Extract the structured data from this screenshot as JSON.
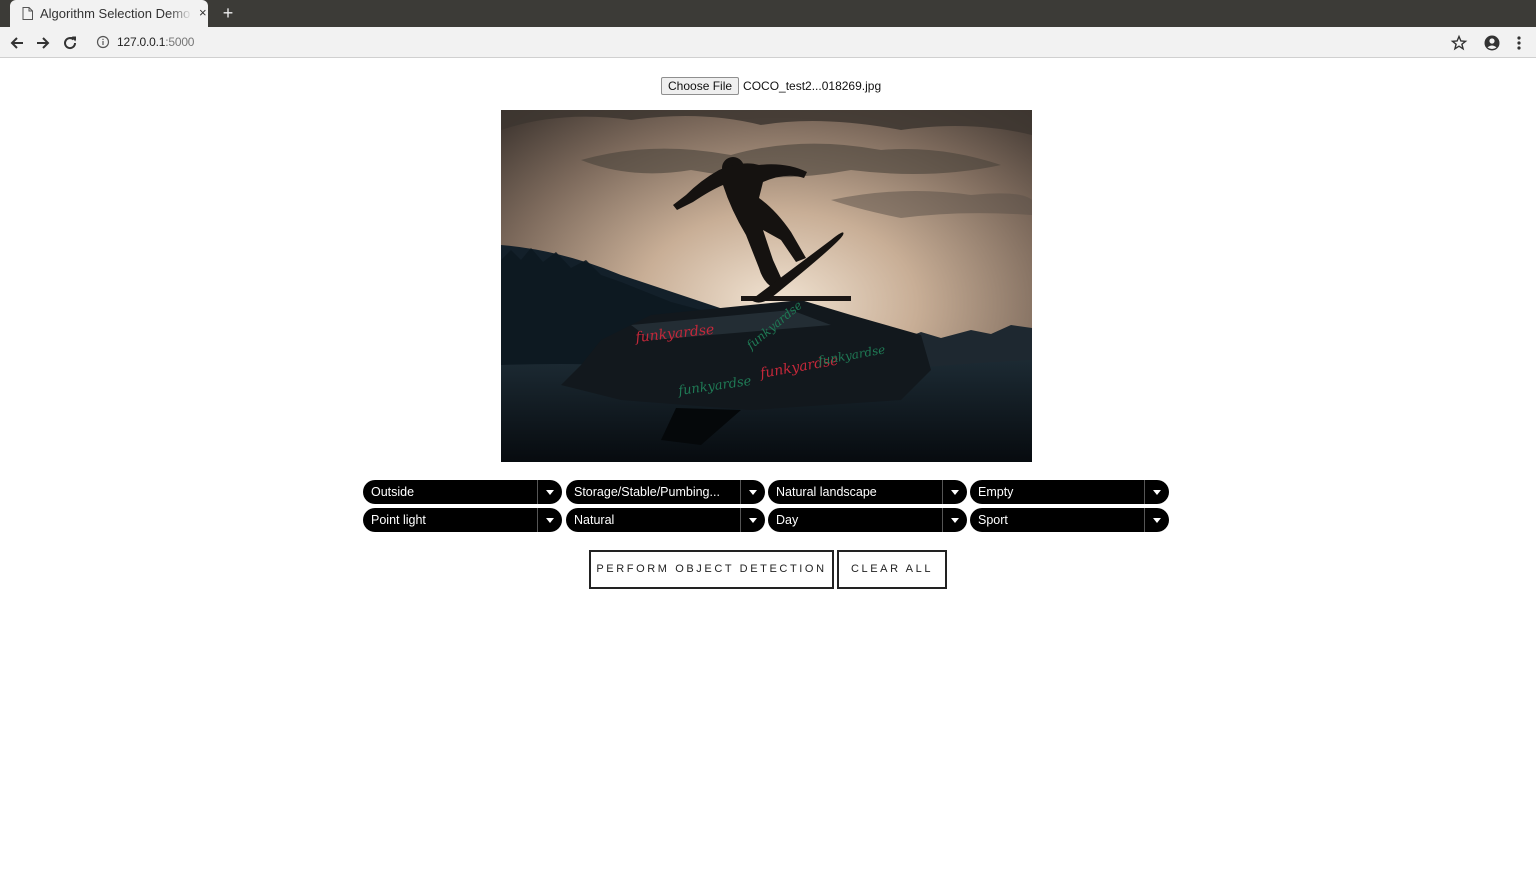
{
  "browser": {
    "tab_title": "Algorithm Selection Demo",
    "tab_close": "×",
    "new_tab": "+",
    "url_host": "127.0.0.1",
    "url_port": ":5000"
  },
  "page": {
    "file_button": "Choose File",
    "file_name": "COCO_test2...018269.jpg",
    "image_alt_text": "funkyardse",
    "selects": [
      {
        "value": "Outside"
      },
      {
        "value": "Storage/Stable/Pumbing..."
      },
      {
        "value": "Natural landscape"
      },
      {
        "value": "Empty"
      },
      {
        "value": "Point light"
      },
      {
        "value": "Natural"
      },
      {
        "value": "Day"
      },
      {
        "value": "Sport"
      }
    ],
    "detect_button": "PERFORM OBJECT DETECTION",
    "clear_button": "CLEAR ALL"
  }
}
